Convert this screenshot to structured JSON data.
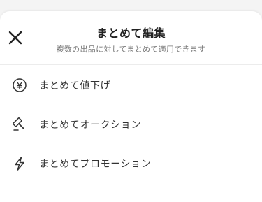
{
  "header": {
    "title": "まとめて編集",
    "subtitle": "複数の出品に対してまとめて適用できます",
    "close_icon": "close-icon"
  },
  "menu": {
    "items": [
      {
        "label": "まとめて値下げ",
        "icon": "yen-circle-icon"
      },
      {
        "label": "まとめてオークション",
        "icon": "gavel-icon"
      },
      {
        "label": "まとめてプロモーション",
        "icon": "lightning-icon"
      }
    ]
  },
  "colors": {
    "text_primary": "#222222",
    "text_secondary": "#777777",
    "background": "#ffffff",
    "divider": "#ececec"
  }
}
